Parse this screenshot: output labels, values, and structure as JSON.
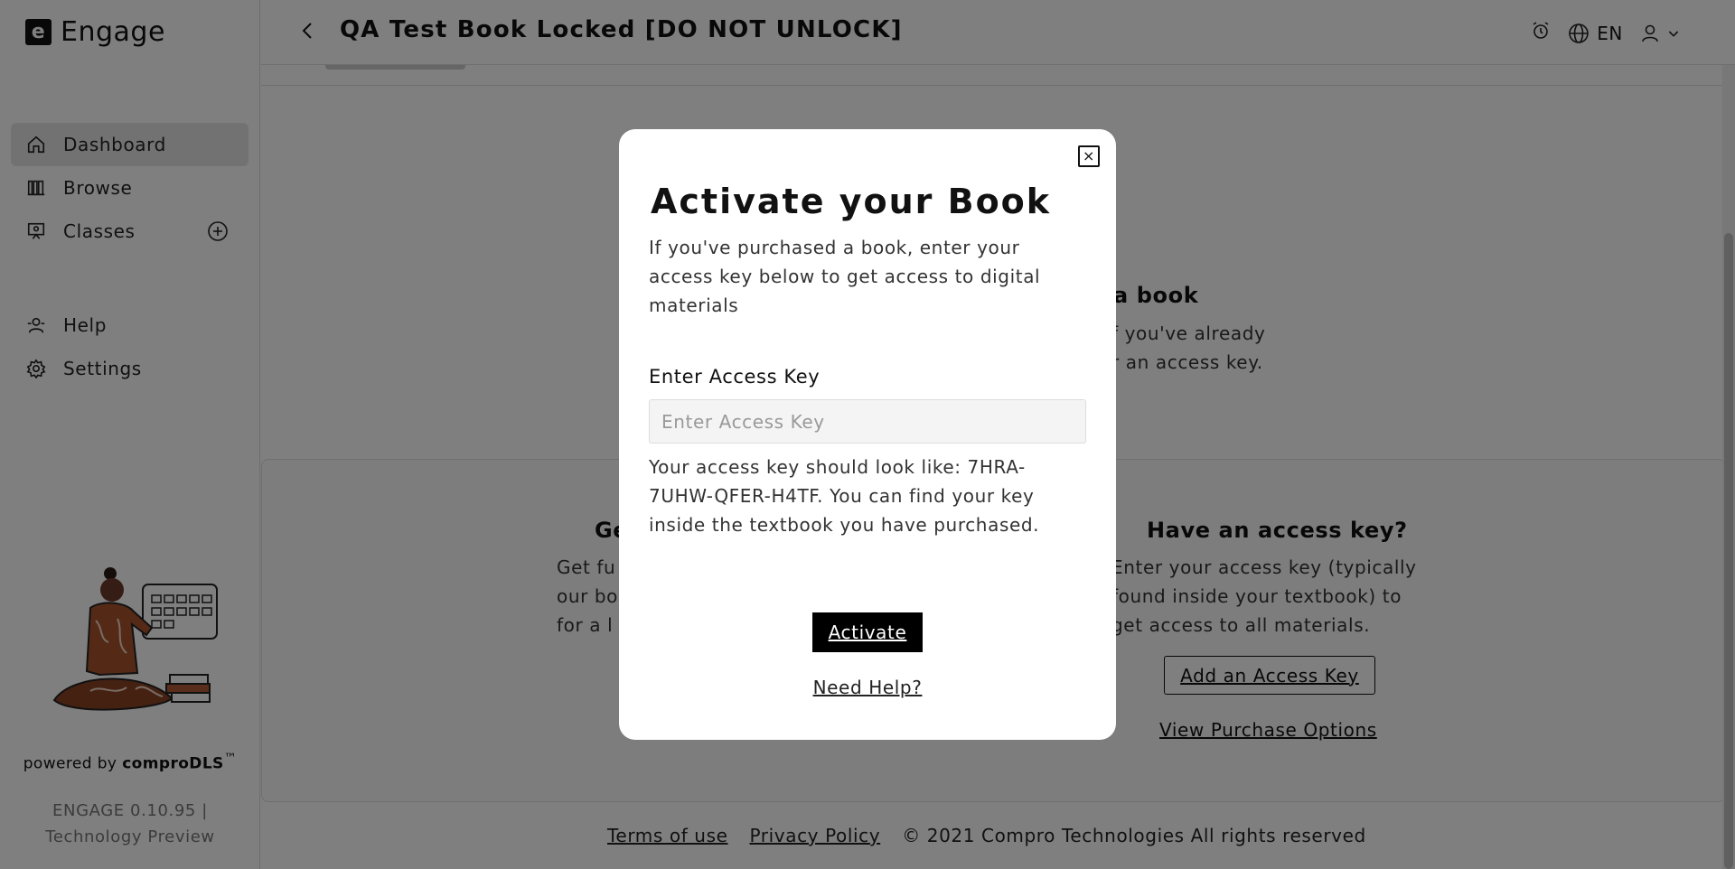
{
  "app": {
    "logo_mark": "e",
    "name": "Engage"
  },
  "sidebar": {
    "items": [
      {
        "label": "Dashboard",
        "icon": "home-icon",
        "active": true
      },
      {
        "label": "Browse",
        "icon": "books-icon"
      },
      {
        "label": "Classes",
        "icon": "class-icon",
        "action_icon": "plus-circle-icon"
      }
    ],
    "secondary": [
      {
        "label": "Help",
        "icon": "help-icon"
      },
      {
        "label": "Settings",
        "icon": "gear-icon"
      }
    ],
    "powered_prefix": "powered by ",
    "powered_brand": "comproDLS",
    "powered_tm": "™",
    "version_line1": "ENGAGE 0.10.95 |",
    "version_line2": "Technology Preview"
  },
  "header": {
    "title": "QA Test Book Locked [DO NOT UNLOCK]",
    "language": "EN"
  },
  "background": {
    "empty_title": "a book",
    "empty_line1": "f you've already",
    "empty_line2": "r an access key.",
    "left_title": "Ge",
    "left_line1": "Get fu",
    "left_line2": "our bo",
    "left_line3": "for a l",
    "right_title": "Have an access key?",
    "right_line1": "Enter your access key (typically",
    "right_line2": "found inside your textbook) to",
    "right_line3": "get access to all materials.",
    "add_key_label": "Add an Access Key",
    "view_options_label": "View Purchase Options"
  },
  "footer": {
    "terms": "Terms of use",
    "privacy": "Privacy Policy",
    "copyright": "© 2021 Compro Technologies All rights reserved"
  },
  "modal": {
    "title": "Activate your Book",
    "description": "If you've purchased a book, enter your access key below to get access to digital materials",
    "field_label": "Enter Access Key",
    "field_placeholder": "Enter Access Key",
    "field_value": "",
    "hint": "Your access key should look like: 7HRA-7UHW-QFER-H4TF. You can find your key inside the textbook you have purchased.",
    "activate_label": "Activate",
    "help_label": "Need Help?",
    "close_glyph": "×"
  }
}
